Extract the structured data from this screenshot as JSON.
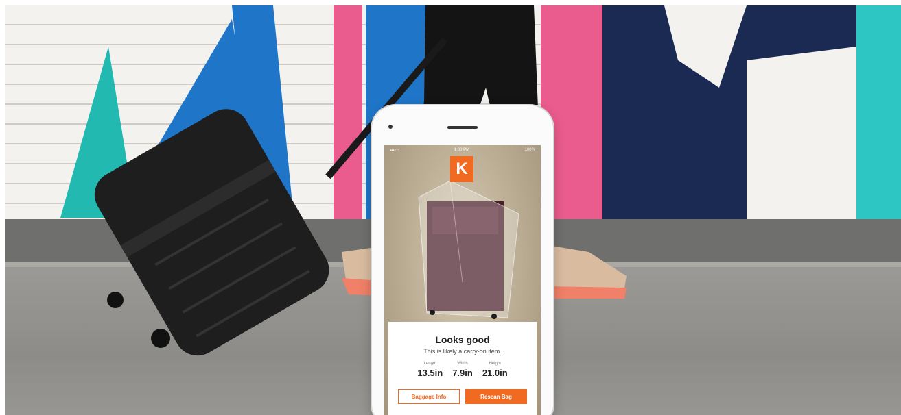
{
  "photo": {
    "subject": "traveler-with-suitcase-icon"
  },
  "app": {
    "logo_letter": "K",
    "status": {
      "time": "1:00 PM",
      "battery": "100%"
    },
    "result": {
      "title": "Looks good",
      "subtitle": "This is likely a carry-on item.",
      "dimensions": [
        {
          "label": "Length",
          "value": "13.5in"
        },
        {
          "label": "Width",
          "value": "7.9in"
        },
        {
          "label": "Height",
          "value": "21.0in"
        }
      ]
    },
    "buttons": {
      "baggage_info": "Baggage Info",
      "rescan": "Rescan Bag"
    },
    "accent": "#f16a22"
  }
}
